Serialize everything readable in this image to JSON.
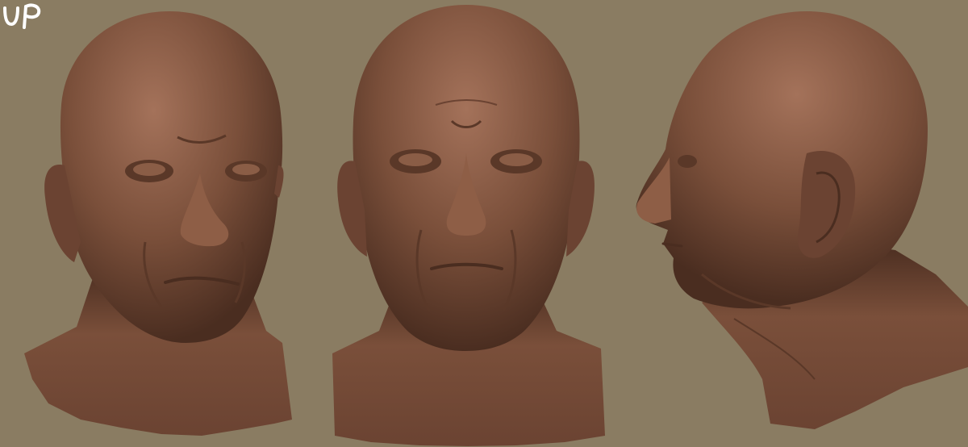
{
  "canvas": {
    "background_color": "#8a7c62",
    "skin_color": "#7a4f3a",
    "skin_highlight": "#a4725a",
    "skin_shadow": "#4a2d20"
  },
  "logo": {
    "text": "UP",
    "color": "#ffffff"
  },
  "views": [
    {
      "name": "three-quarter-view"
    },
    {
      "name": "front-view"
    },
    {
      "name": "profile-view"
    }
  ]
}
